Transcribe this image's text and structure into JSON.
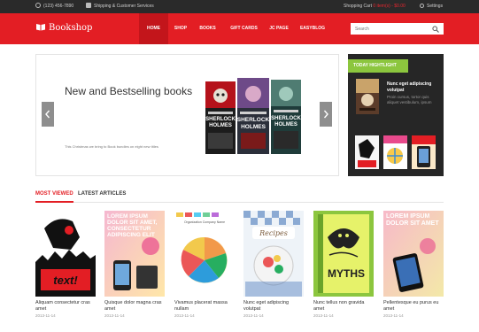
{
  "topbar": {
    "phone": "(123) 456-7890",
    "shipping": "Shipping & Customer Services",
    "cart_label": "Shopping Cart",
    "cart_items": "0 item(s)",
    "cart_sep": " - ",
    "cart_total": "$0.00",
    "settings": "Settings"
  },
  "brand": {
    "name": "Bookshop",
    "accent": "#e31e24",
    "dark": "#262626",
    "highlight": "#8cc63e"
  },
  "nav": [
    {
      "label": "HOME"
    },
    {
      "label": "SHOP"
    },
    {
      "label": "BOOKS"
    },
    {
      "label": "GIFT CARDS"
    },
    {
      "label": "JC PAGE"
    },
    {
      "label": "EASYBLOG"
    }
  ],
  "search": {
    "placeholder": "Search"
  },
  "slider": {
    "title": "New and Bestselling books",
    "subtitle": "This Christmas we bring to Book bundles on eight new titles",
    "cover_texts": [
      "SHERLOCK",
      "HOLMES"
    ]
  },
  "today": {
    "heading": "TODAY HIGHTLIGHT",
    "title": "Nunc eget adipiscing volutpat",
    "description": "Proin cursus, tortor quis aliquet vestibulum, ipsum"
  },
  "tabs": {
    "most_viewed": "MOST VIEWED",
    "latest": "LATEST ARTICLES"
  },
  "products": [
    {
      "title": "Aliquam consectetur cras amet",
      "date": "2013-11-14",
      "cover_text": "text!"
    },
    {
      "title": "Quisque dolor magna cras amet",
      "date": "2013-11-14",
      "cover_text": "LOREM IPSUM DOLOR SIT AMET, CONSECTETUR ADIPISCING ELIT"
    },
    {
      "title": "Vivamus placerat massa nullam",
      "date": "2013-11-14",
      "cover_text": "Organization Company Name"
    },
    {
      "title": "Nunc eget adipiscing volutpat",
      "date": "2013-11-14",
      "cover_text": "Recipes"
    },
    {
      "title": "Nunc tellus non gravida amet",
      "date": "2013-11-14",
      "cover_text": "MYTHS"
    },
    {
      "title": "Pellentesque eu purus eu amet",
      "date": "2013-11-14",
      "cover_text": "LOREM IPSUM DOLOR SIT AMET"
    }
  ]
}
